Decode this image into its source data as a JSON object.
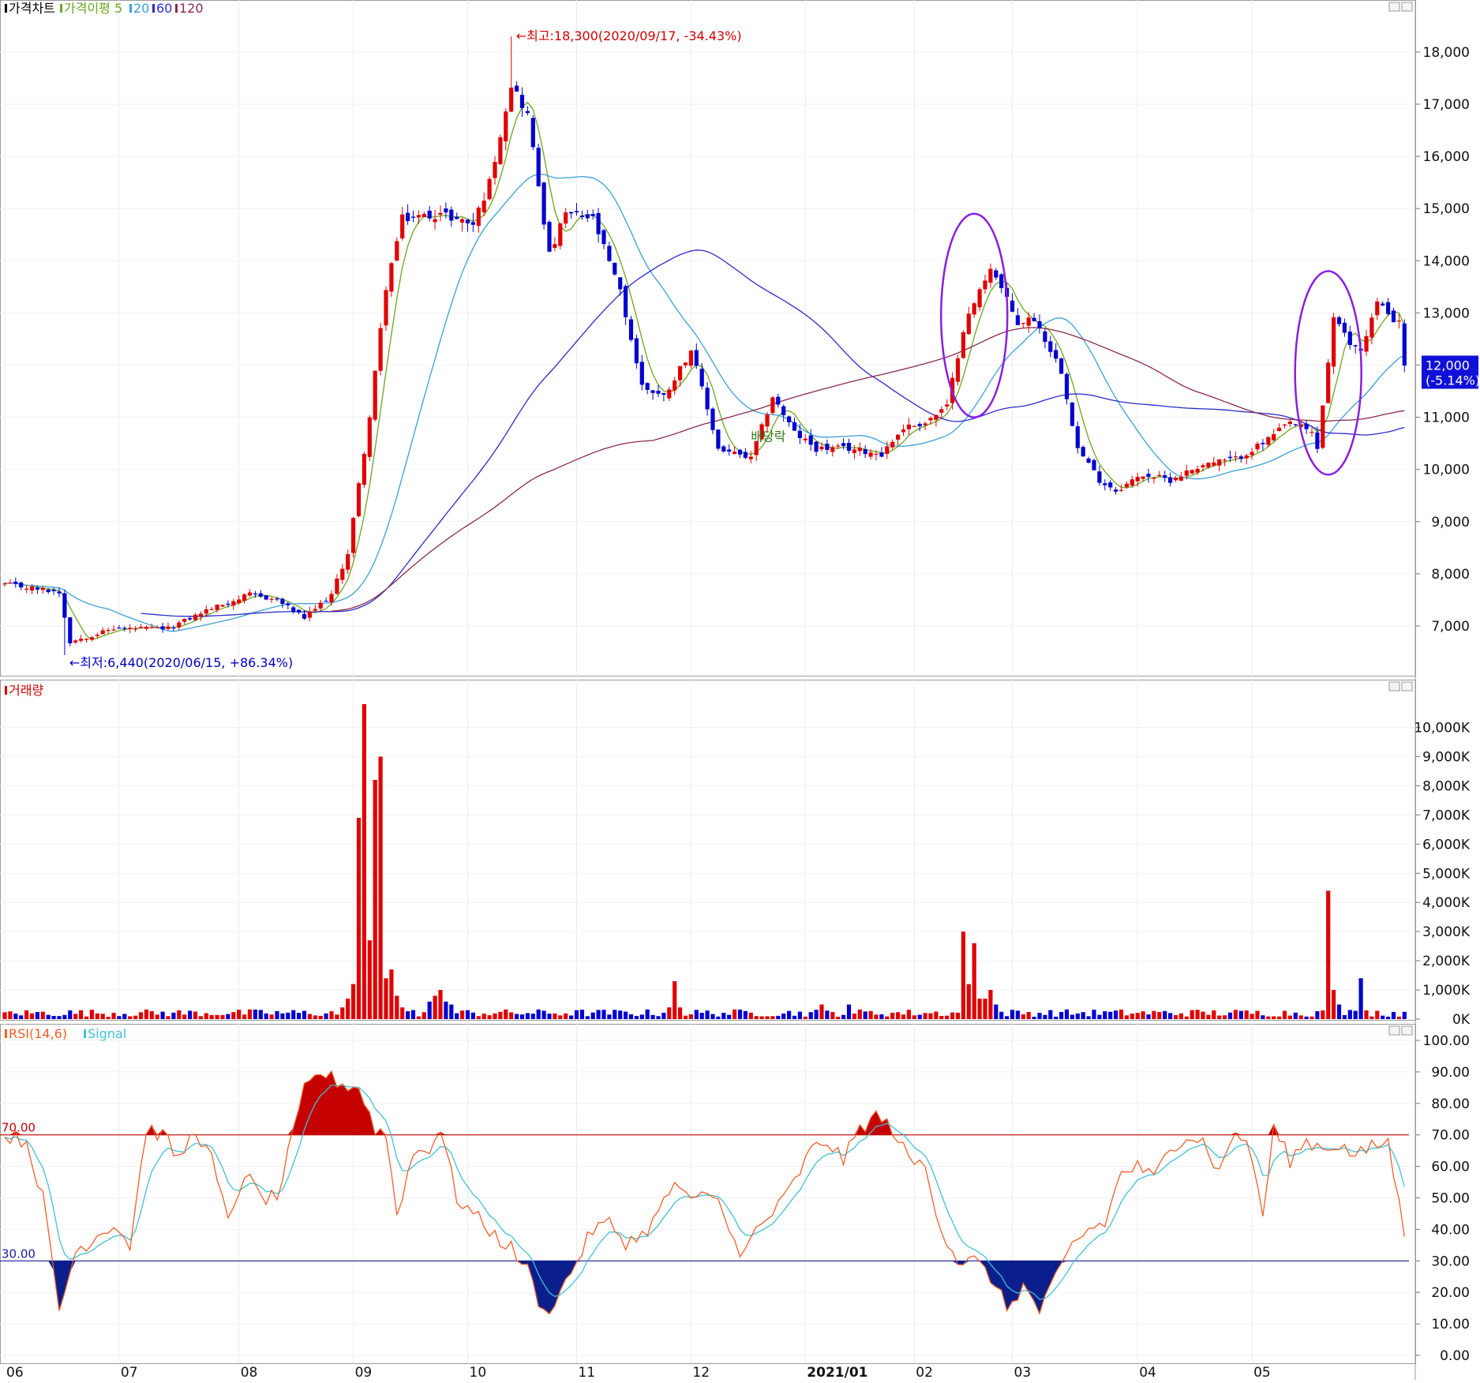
{
  "chart_data": [
    {
      "type": "candlestick",
      "panel": "price",
      "legend": {
        "title": "가격차트",
        "ma_label": "가격이평",
        "ma_periods": [
          "5",
          "20",
          "60",
          "120"
        ],
        "ma_colors": [
          "#6aa820",
          "#3aa0d8",
          "#2b2bc8",
          "#8a2a4a"
        ]
      },
      "annotations": {
        "high": "←최고:18,300(2020/09/17, -34.43%)",
        "low": "←최저:6,440(2020/06/15, +86.34%)",
        "event": "배당락",
        "current_price": "12,000",
        "current_change": "(-5.14%)"
      },
      "ylim": [
        6000,
        19000
      ],
      "y_ticks": [
        {
          "value": 18000,
          "label": "18,000"
        },
        {
          "value": 17000,
          "label": "17,000"
        },
        {
          "value": 16000,
          "label": "16,000"
        },
        {
          "value": 15000,
          "label": "15,000"
        },
        {
          "value": 14000,
          "label": "14,000"
        },
        {
          "value": 13000,
          "label": "13,000"
        },
        {
          "value": 12000,
          "label": "12,000"
        },
        {
          "value": 11000,
          "label": "11,000"
        },
        {
          "value": 10000,
          "label": "10,000"
        },
        {
          "value": 9000,
          "label": "9,000"
        },
        {
          "value": 8000,
          "label": "8,000"
        },
        {
          "value": 7000,
          "label": "7,000"
        }
      ],
      "close_anchors": [
        [
          0,
          7800
        ],
        [
          10,
          7650
        ],
        [
          12,
          6700
        ],
        [
          20,
          6950
        ],
        [
          30,
          6950
        ],
        [
          37,
          7300
        ],
        [
          45,
          7600
        ],
        [
          50,
          7500
        ],
        [
          55,
          7150
        ],
        [
          60,
          7600
        ],
        [
          63,
          8400
        ],
        [
          67,
          11000
        ],
        [
          70,
          13500
        ],
        [
          73,
          14800
        ],
        [
          80,
          14900
        ],
        [
          86,
          14700
        ],
        [
          89,
          15500
        ],
        [
          93,
          17400
        ],
        [
          96,
          16800
        ],
        [
          100,
          14100
        ],
        [
          103,
          14900
        ],
        [
          108,
          14800
        ],
        [
          113,
          13400
        ],
        [
          117,
          11600
        ],
        [
          121,
          11400
        ],
        [
          126,
          12300
        ],
        [
          131,
          10400
        ],
        [
          137,
          10200
        ],
        [
          141,
          11400
        ],
        [
          145,
          10700
        ],
        [
          149,
          10400
        ],
        [
          155,
          10400
        ],
        [
          161,
          10300
        ],
        [
          165,
          10800
        ],
        [
          169,
          10900
        ],
        [
          173,
          11200
        ],
        [
          176,
          12700
        ],
        [
          181,
          13900
        ],
        [
          186,
          12800
        ],
        [
          189,
          12900
        ],
        [
          194,
          11900
        ],
        [
          197,
          10400
        ],
        [
          201,
          9800
        ],
        [
          204,
          9600
        ],
        [
          209,
          9900
        ],
        [
          214,
          9800
        ],
        [
          220,
          10100
        ],
        [
          226,
          10200
        ],
        [
          231,
          10500
        ],
        [
          236,
          10900
        ],
        [
          240,
          10700
        ],
        [
          241,
          10400
        ],
        [
          244,
          12900
        ],
        [
          247,
          12400
        ],
        [
          249,
          12300
        ],
        [
          252,
          13200
        ],
        [
          255,
          12900
        ],
        [
          256,
          12800
        ],
        [
          257,
          12000
        ]
      ],
      "ma_lines": {
        "ma60_from_index": 25,
        "ma120_from_index": 60
      },
      "x_month_ticks": [
        {
          "label": "06",
          "index": 0
        },
        {
          "label": "07",
          "index": 21
        },
        {
          "label": "08",
          "index": 43
        },
        {
          "label": "09",
          "index": 64
        },
        {
          "label": "10",
          "index": 85
        },
        {
          "label": "11",
          "index": 105
        },
        {
          "label": "12",
          "index": 126
        },
        {
          "label": "2021/01",
          "index": 147
        },
        {
          "label": "02",
          "index": 167
        },
        {
          "label": "03",
          "index": 185
        },
        {
          "label": "04",
          "index": 208
        },
        {
          "label": "05",
          "index": 229
        }
      ],
      "highlight_ellipses": [
        {
          "center_index": 178,
          "low": 11000,
          "high": 14900
        },
        {
          "center_index": 243,
          "low": 9900,
          "high": 13800
        }
      ]
    },
    {
      "type": "bar",
      "panel": "volume",
      "legend": {
        "title": "거래량"
      },
      "unit": "K",
      "ylim": [
        0,
        10800
      ],
      "y_ticks": [
        {
          "value": 10000,
          "label": "10,000K"
        },
        {
          "value": 9000,
          "label": "9,000K"
        },
        {
          "value": 8000,
          "label": "8,000K"
        },
        {
          "value": 7000,
          "label": "7,000K"
        },
        {
          "value": 6000,
          "label": "6,000K"
        },
        {
          "value": 5000,
          "label": "5,000K"
        },
        {
          "value": 4000,
          "label": "4,000K"
        },
        {
          "value": 3000,
          "label": "3,000K"
        },
        {
          "value": 2000,
          "label": "2,000K"
        },
        {
          "value": 1000,
          "label": "1,000K"
        },
        {
          "value": 0,
          "label": "0K"
        }
      ],
      "spikes": [
        [
          62,
          400
        ],
        [
          63,
          700
        ],
        [
          64,
          1200
        ],
        [
          65,
          6900
        ],
        [
          66,
          10800
        ],
        [
          67,
          2700
        ],
        [
          68,
          8200
        ],
        [
          69,
          9000
        ],
        [
          70,
          1400
        ],
        [
          71,
          1700
        ],
        [
          72,
          800
        ],
        [
          73,
          400
        ],
        [
          78,
          600
        ],
        [
          79,
          800
        ],
        [
          80,
          1000
        ],
        [
          81,
          600
        ],
        [
          82,
          500
        ],
        [
          122,
          400
        ],
        [
          123,
          1300
        ],
        [
          124,
          400
        ],
        [
          150,
          500
        ],
        [
          155,
          500
        ],
        [
          176,
          3000
        ],
        [
          177,
          1200
        ],
        [
          178,
          2600
        ],
        [
          179,
          700
        ],
        [
          180,
          700
        ],
        [
          181,
          1000
        ],
        [
          182,
          500
        ],
        [
          243,
          4400
        ],
        [
          244,
          1000
        ],
        [
          245,
          500
        ],
        [
          249,
          1400
        ],
        [
          250,
          300
        ]
      ]
    },
    {
      "type": "line",
      "panel": "rsi",
      "legend": {
        "rsi": "RSI(14,6)",
        "signal": "Signal"
      },
      "ylim": [
        0,
        100
      ],
      "y_ticks": [
        {
          "value": 100,
          "label": "100.00"
        },
        {
          "value": 90,
          "label": "90.00"
        },
        {
          "value": 80,
          "label": "80.00"
        },
        {
          "value": 70,
          "label": "70.00"
        },
        {
          "value": 60,
          "label": "60.00"
        },
        {
          "value": 50,
          "label": "50.00"
        },
        {
          "value": 40,
          "label": "40.00"
        },
        {
          "value": 30,
          "label": "30.00"
        },
        {
          "value": 20,
          "label": "20.00"
        },
        {
          "value": 10,
          "label": "10.00"
        },
        {
          "value": 0,
          "label": "0.00"
        }
      ],
      "overbought": {
        "value": 70,
        "label": "70.00"
      },
      "oversold": {
        "value": 30,
        "label": "30.00"
      },
      "rsi_anchors": [
        [
          0,
          70
        ],
        [
          4,
          68
        ],
        [
          7,
          50
        ],
        [
          10,
          14
        ],
        [
          13,
          33
        ],
        [
          20,
          42
        ],
        [
          23,
          35
        ],
        [
          26,
          72
        ],
        [
          29,
          70
        ],
        [
          32,
          62
        ],
        [
          35,
          72
        ],
        [
          38,
          62
        ],
        [
          41,
          42
        ],
        [
          44,
          58
        ],
        [
          47,
          50
        ],
        [
          50,
          50
        ],
        [
          53,
          70
        ],
        [
          55,
          84
        ],
        [
          58,
          90
        ],
        [
          62,
          86
        ],
        [
          65,
          85
        ],
        [
          68,
          72
        ],
        [
          70,
          70
        ],
        [
          72,
          45
        ],
        [
          75,
          64
        ],
        [
          78,
          66
        ],
        [
          80,
          72
        ],
        [
          83,
          50
        ],
        [
          86,
          45
        ],
        [
          90,
          38
        ],
        [
          93,
          34
        ],
        [
          96,
          27
        ],
        [
          99,
          13
        ],
        [
          102,
          20
        ],
        [
          105,
          30
        ],
        [
          108,
          40
        ],
        [
          111,
          42
        ],
        [
          114,
          36
        ],
        [
          117,
          38
        ],
        [
          120,
          45
        ],
        [
          123,
          55
        ],
        [
          126,
          48
        ],
        [
          129,
          52
        ],
        [
          132,
          47
        ],
        [
          135,
          30
        ],
        [
          138,
          40
        ],
        [
          142,
          47
        ],
        [
          145,
          55
        ],
        [
          148,
          65
        ],
        [
          151,
          68
        ],
        [
          154,
          62
        ],
        [
          157,
          72
        ],
        [
          160,
          76
        ],
        [
          163,
          72
        ],
        [
          166,
          62
        ],
        [
          169,
          60
        ],
        [
          172,
          40
        ],
        [
          175,
          30
        ],
        [
          178,
          30
        ],
        [
          181,
          25
        ],
        [
          184,
          15
        ],
        [
          187,
          22
        ],
        [
          190,
          14
        ],
        [
          193,
          24
        ],
        [
          196,
          35
        ],
        [
          199,
          40
        ],
        [
          202,
          42
        ],
        [
          205,
          58
        ],
        [
          208,
          60
        ],
        [
          211,
          56
        ],
        [
          214,
          66
        ],
        [
          217,
          70
        ],
        [
          220,
          68
        ],
        [
          223,
          58
        ],
        [
          226,
          72
        ],
        [
          229,
          63
        ],
        [
          231,
          44
        ],
        [
          233,
          72
        ],
        [
          236,
          62
        ],
        [
          239,
          68
        ],
        [
          242,
          66
        ],
        [
          245,
          67
        ],
        [
          248,
          63
        ],
        [
          251,
          66
        ],
        [
          254,
          68
        ],
        [
          257,
          38
        ]
      ],
      "signal_period": 6
    }
  ]
}
